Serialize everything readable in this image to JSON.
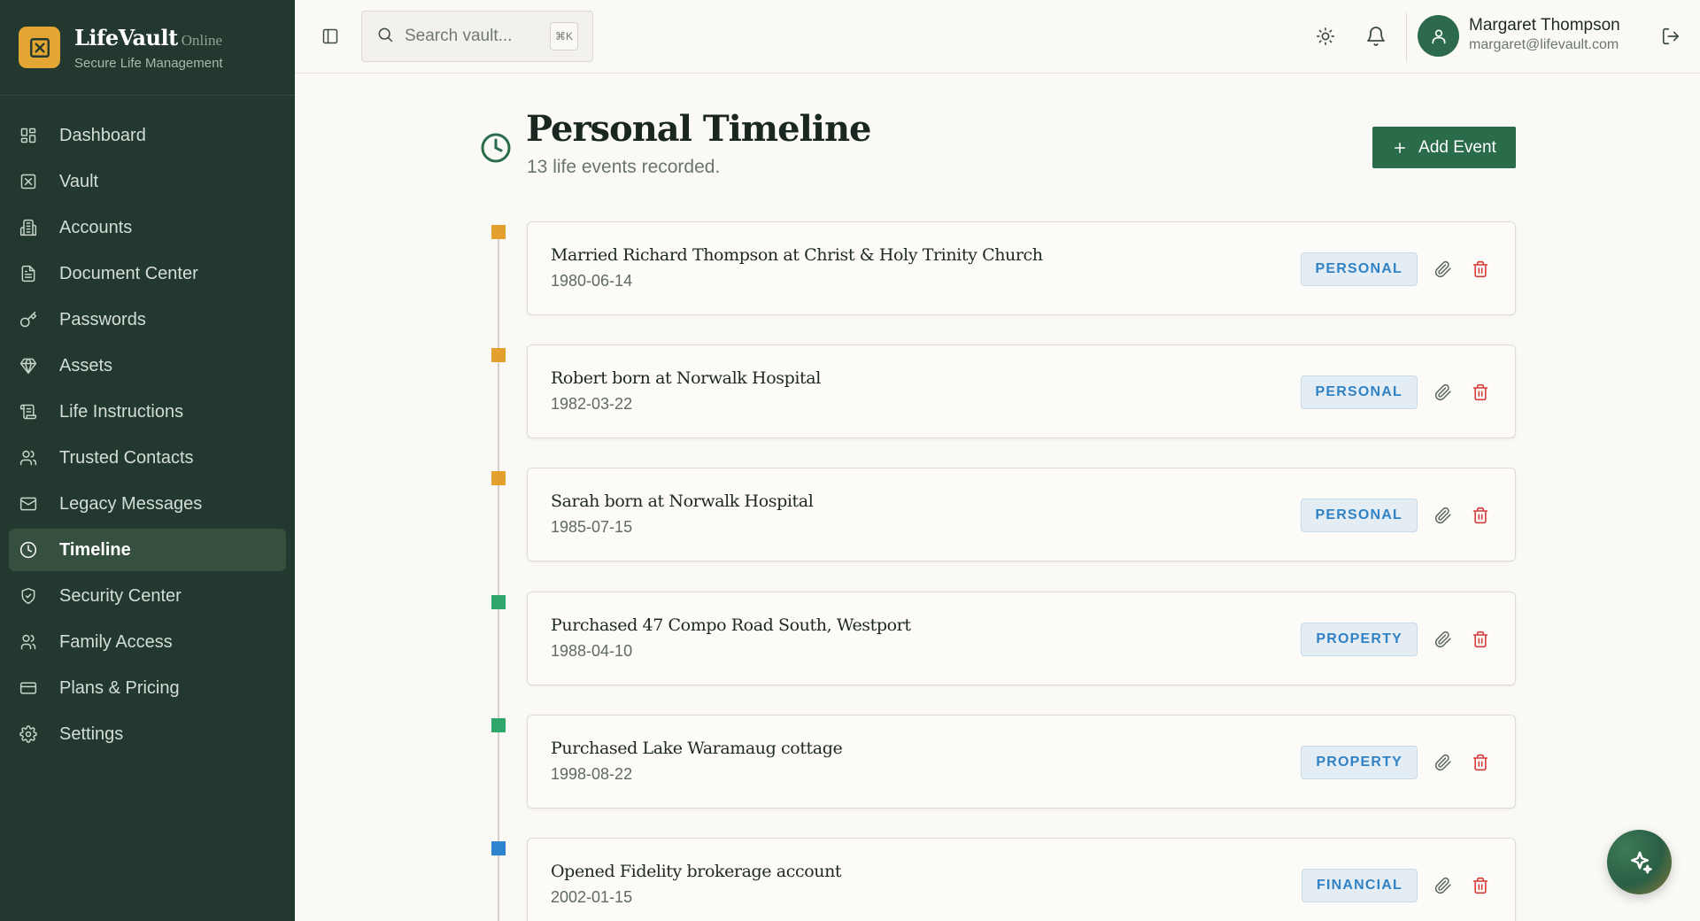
{
  "brand": {
    "name": "LifeVault",
    "status": "Online",
    "tagline": "Secure Life Management"
  },
  "sidebar": {
    "items": [
      {
        "label": "Dashboard",
        "icon": "dashboard-icon"
      },
      {
        "label": "Vault",
        "icon": "vault-icon"
      },
      {
        "label": "Accounts",
        "icon": "accounts-icon"
      },
      {
        "label": "Document Center",
        "icon": "document-icon"
      },
      {
        "label": "Passwords",
        "icon": "key-icon"
      },
      {
        "label": "Assets",
        "icon": "gem-icon"
      },
      {
        "label": "Life Instructions",
        "icon": "scroll-icon"
      },
      {
        "label": "Trusted Contacts",
        "icon": "users-icon"
      },
      {
        "label": "Legacy Messages",
        "icon": "mail-icon"
      },
      {
        "label": "Timeline",
        "icon": "clock-icon",
        "active": true
      },
      {
        "label": "Security Center",
        "icon": "shield-check-icon"
      },
      {
        "label": "Family Access",
        "icon": "family-icon"
      },
      {
        "label": "Plans & Pricing",
        "icon": "credit-card-icon"
      },
      {
        "label": "Settings",
        "icon": "gear-icon"
      }
    ]
  },
  "topbar": {
    "search_placeholder": "Search vault...",
    "shortcut": "⌘K",
    "user": {
      "name": "Margaret Thompson",
      "email": "margaret@lifevault.com"
    }
  },
  "page": {
    "title": "Personal Timeline",
    "subtitle": "13 life events recorded.",
    "add_button": "Add Event"
  },
  "events": [
    {
      "title": "Married Richard Thompson at Christ & Holy Trinity Church",
      "date": "1980-06-14",
      "category": "PERSONAL",
      "marker_color": "#e3a02f"
    },
    {
      "title": "Robert born at Norwalk Hospital",
      "date": "1982-03-22",
      "category": "PERSONAL",
      "marker_color": "#e3a02f"
    },
    {
      "title": "Sarah born at Norwalk Hospital",
      "date": "1985-07-15",
      "category": "PERSONAL",
      "marker_color": "#e3a02f"
    },
    {
      "title": "Purchased 47 Compo Road South, Westport",
      "date": "1988-04-10",
      "category": "PROPERTY",
      "marker_color": "#2fa66a"
    },
    {
      "title": "Purchased Lake Waramaug cottage",
      "date": "1998-08-22",
      "category": "PROPERTY",
      "marker_color": "#2fa66a"
    },
    {
      "title": "Opened Fidelity brokerage account",
      "date": "2002-01-15",
      "category": "FINANCIAL",
      "marker_color": "#2f84cf"
    }
  ],
  "colors": {
    "sidebar_bg": "#23392f",
    "accent": "#2a6b4a",
    "brand_logo": "#e3a533",
    "badge_text": "#3182c4",
    "delete": "#d63b3b"
  }
}
